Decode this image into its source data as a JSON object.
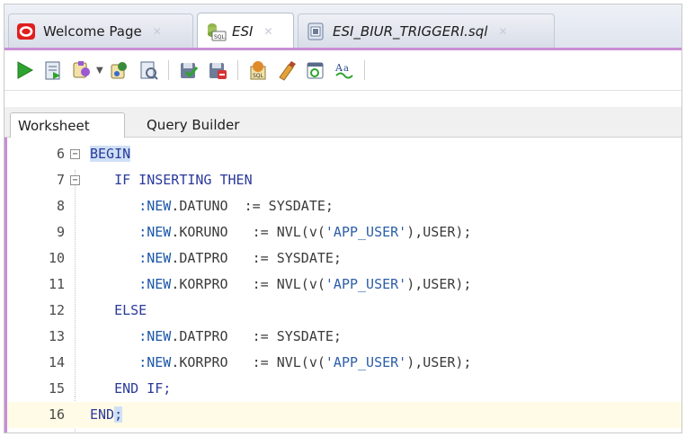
{
  "tabs": [
    {
      "label": "Welcome Page",
      "icon": "oracle-logo-icon",
      "active": false
    },
    {
      "label": "ESI",
      "icon": "sql-connection-icon",
      "active": true
    },
    {
      "label": "ESI_BIUR_TRIGGERI.sql",
      "icon": "sql-file-icon",
      "active": false
    }
  ],
  "toolbar": [
    "run-statement-icon",
    "run-script-icon",
    "autotrace-icon",
    "explain-plan-icon",
    "sql-tuning-advisor-icon",
    "commit-icon",
    "rollback-icon",
    "sql-history-icon",
    "clear-icon",
    "unshared-worksheet-icon",
    "format-icon"
  ],
  "subtabs": [
    "Worksheet",
    "Query Builder"
  ],
  "colors": {
    "accent_magenta": "#c98fd6",
    "keyword": "#2b3a9b",
    "string": "#2c5ea8",
    "current_line": "#fffbe6",
    "match_highlight": "#cfe0f6"
  },
  "editor": {
    "lines": [
      {
        "num": "6",
        "indent": "",
        "tokens": [
          {
            "t": "BEGIN",
            "c": "kw hl"
          }
        ]
      },
      {
        "num": "7",
        "indent": "   ",
        "tokens": [
          {
            "t": "IF INSERTING THEN",
            "c": "kw"
          }
        ]
      },
      {
        "num": "8",
        "indent": "      ",
        "tokens": [
          {
            "t": ":NEW",
            "c": "bind"
          },
          {
            "t": ".DATUNO  := SYSDATE;",
            "c": ""
          }
        ]
      },
      {
        "num": "9",
        "indent": "      ",
        "tokens": [
          {
            "t": ":NEW",
            "c": "bind"
          },
          {
            "t": ".KORUNO   := NVL(v(",
            "c": ""
          },
          {
            "t": "'APP_USER'",
            "c": "str"
          },
          {
            "t": "),USER);",
            "c": ""
          }
        ]
      },
      {
        "num": "10",
        "indent": "      ",
        "tokens": [
          {
            "t": ":NEW",
            "c": "bind"
          },
          {
            "t": ".DATPRO   := SYSDATE;",
            "c": ""
          }
        ]
      },
      {
        "num": "11",
        "indent": "      ",
        "tokens": [
          {
            "t": ":NEW",
            "c": "bind"
          },
          {
            "t": ".KORPRO   := NVL(v(",
            "c": ""
          },
          {
            "t": "'APP_USER'",
            "c": "str"
          },
          {
            "t": "),USER);",
            "c": ""
          }
        ]
      },
      {
        "num": "12",
        "indent": "   ",
        "tokens": [
          {
            "t": "ELSE",
            "c": "kw"
          }
        ]
      },
      {
        "num": "13",
        "indent": "      ",
        "tokens": [
          {
            "t": ":NEW",
            "c": "bind"
          },
          {
            "t": ".DATPRO   := SYSDATE;",
            "c": ""
          }
        ]
      },
      {
        "num": "14",
        "indent": "      ",
        "tokens": [
          {
            "t": ":NEW",
            "c": "bind"
          },
          {
            "t": ".KORPRO   := NVL(v(",
            "c": ""
          },
          {
            "t": "'APP_USER'",
            "c": "str"
          },
          {
            "t": "),USER);",
            "c": ""
          }
        ]
      },
      {
        "num": "15",
        "indent": "   ",
        "tokens": [
          {
            "t": "END IF;",
            "c": "kw"
          }
        ]
      },
      {
        "num": "16",
        "indent": "",
        "tokens": [
          {
            "t": "END",
            "c": "kw"
          },
          {
            "t": ";",
            "c": "kw hl"
          }
        ]
      }
    ],
    "current_line": "16"
  }
}
